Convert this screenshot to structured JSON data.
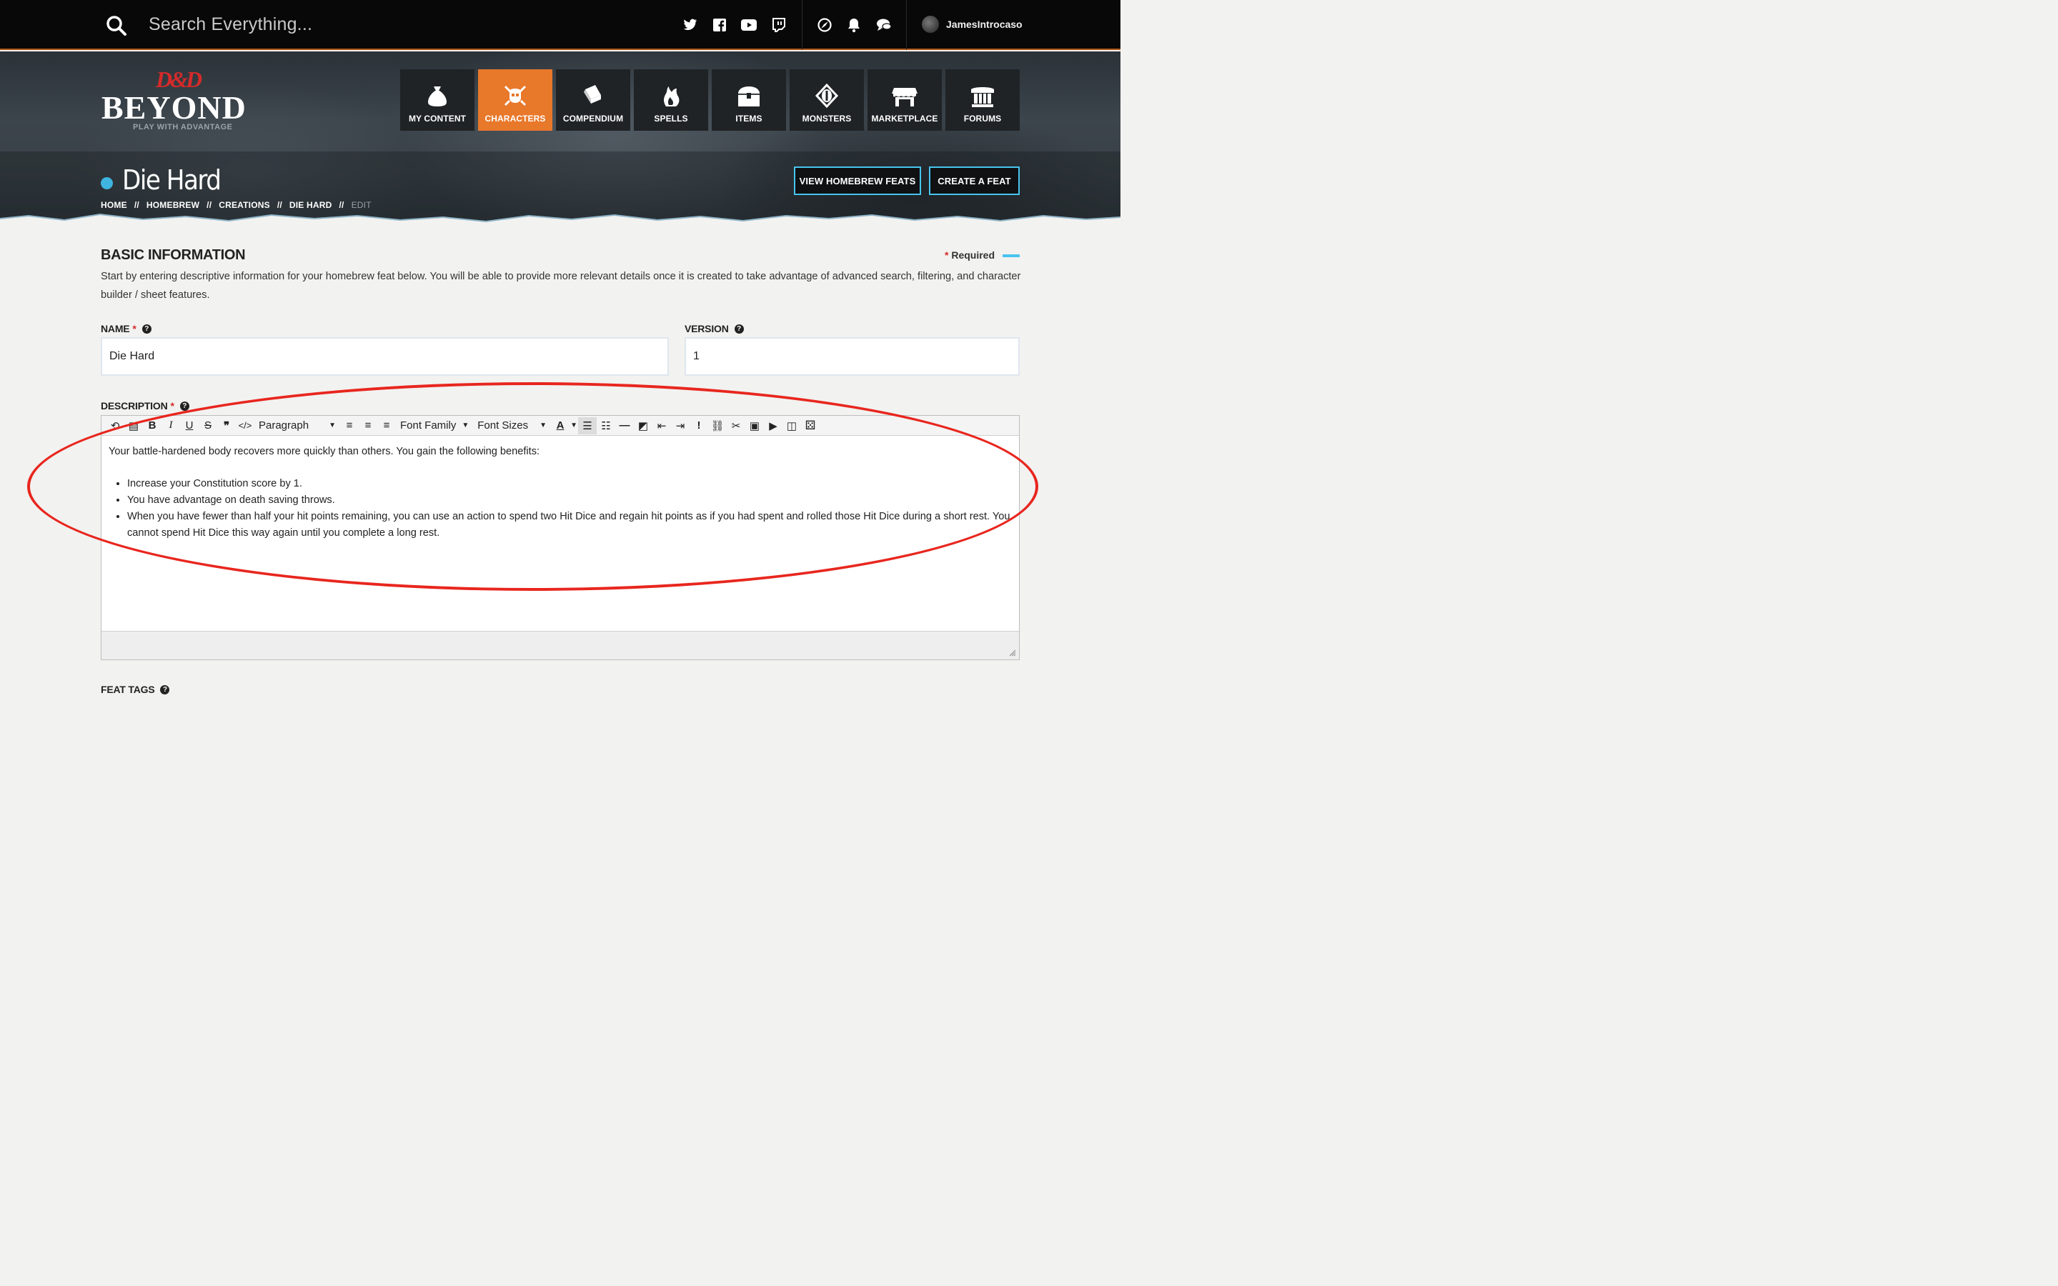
{
  "topbar": {
    "search_placeholder": "Search Everything...",
    "social": [
      "twitter-icon",
      "facebook-icon",
      "youtube-icon",
      "twitch-icon"
    ],
    "user": {
      "name": "JamesIntrocaso"
    }
  },
  "logo": {
    "dd": "D&D",
    "beyond": "BEYOND",
    "tagline": "PLAY WITH ADVANTAGE"
  },
  "nav": [
    {
      "label": "MY CONTENT",
      "icon": "bag-icon",
      "active": false
    },
    {
      "label": "CHARACTERS",
      "icon": "helmet-icon",
      "active": true
    },
    {
      "label": "COMPENDIUM",
      "icon": "book-icon",
      "active": false
    },
    {
      "label": "SPELLS",
      "icon": "flame-hand-icon",
      "active": false
    },
    {
      "label": "ITEMS",
      "icon": "chest-icon",
      "active": false
    },
    {
      "label": "MONSTERS",
      "icon": "eye-icon",
      "active": false
    },
    {
      "label": "MARKETPLACE",
      "icon": "shop-icon",
      "active": false
    },
    {
      "label": "FORUMS",
      "icon": "column-icon",
      "active": false
    }
  ],
  "page": {
    "title": "Die Hard",
    "breadcrumbs": [
      "HOME",
      "HOMEBREW",
      "CREATIONS",
      "DIE HARD",
      "EDIT"
    ],
    "breadcrumb_sep": "//",
    "buttons": {
      "view_feats": "VIEW HOMEBREW FEATS",
      "create_feat": "CREATE A FEAT"
    }
  },
  "form": {
    "section_title": "BASIC INFORMATION",
    "required_label": "Required",
    "required_star": "*",
    "intro": "Start by entering descriptive information for your homebrew feat below. You will be able to provide more relevant details once it is created to take advantage of advanced search, filtering, and character builder / sheet features.",
    "name_label": "NAME",
    "name_value": "Die Hard",
    "version_label": "VERSION",
    "version_value": "1",
    "description_label": "DESCRIPTION",
    "feat_tags_label": "FEAT TAGS",
    "help_glyph": "?"
  },
  "editor": {
    "toolbar": {
      "format_select": "Paragraph",
      "font_family": "Font Family",
      "font_sizes": "Font Sizes"
    },
    "intro": "Your battle-hardened body recovers more quickly than others. You gain the following benefits:",
    "bullets": [
      "Increase your Constitution score by 1.",
      "You have advantage on death saving throws.",
      "When you have fewer than half your hit points remaining, you can use an action to spend two Hit Dice and regain hit points as if you had spent and rolled those Hit Dice during a short rest. You cannot spend Hit Dice this way again until you complete a long rest."
    ]
  },
  "colors": {
    "accent_orange": "#e8782a",
    "accent_blue": "#48c4ee",
    "logo_red": "#d42a2a",
    "annotation_red": "#e8261e"
  }
}
